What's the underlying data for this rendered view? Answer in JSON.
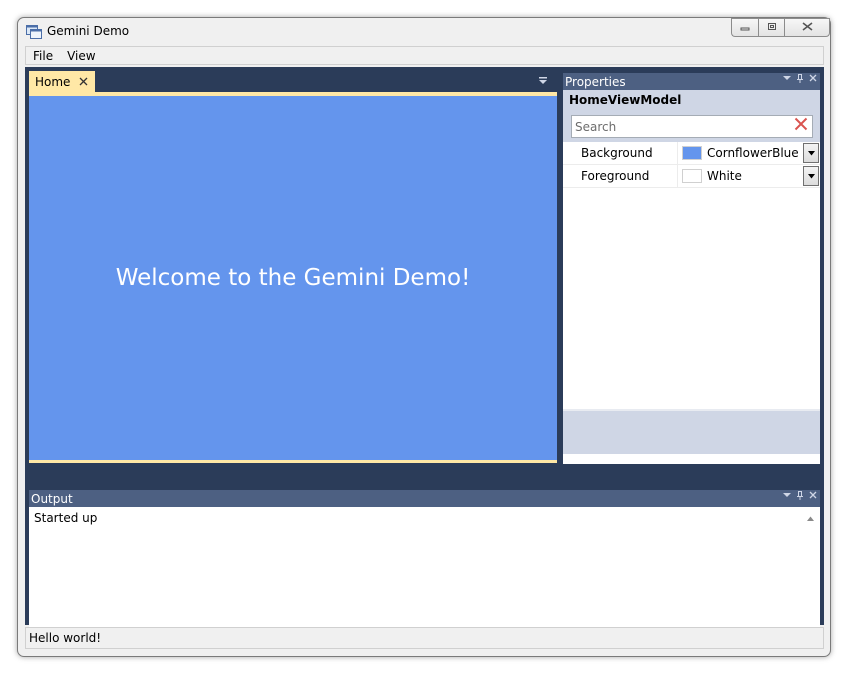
{
  "window": {
    "title": "Gemini Demo",
    "icon": "app-window-icon",
    "caption_buttons": {
      "minimize": "minimize-icon",
      "maximize": "maximize-icon",
      "close": "close-icon"
    }
  },
  "menu": {
    "items": [
      {
        "label": "File"
      },
      {
        "label": "View"
      }
    ]
  },
  "document": {
    "tab_label": "Home",
    "welcome_text": "Welcome to the Gemini Demo!",
    "background_color": "#6495ED",
    "foreground_color": "#FFFFFF"
  },
  "properties": {
    "header": "Properties",
    "object_name": "HomeViewModel",
    "search_placeholder": "Search",
    "rows": [
      {
        "name": "Background",
        "value": "CornflowerBlue",
        "swatch": "#6495ED"
      },
      {
        "name": "Foreground",
        "value": "White",
        "swatch": "#FFFFFF"
      }
    ]
  },
  "output": {
    "header": "Output",
    "text": "Started up"
  },
  "status": {
    "text": "Hello world!"
  },
  "colors": {
    "dock_background": "#2B3C59",
    "tab_active": "#FFE8A6",
    "tool_header": "#4D6082"
  }
}
